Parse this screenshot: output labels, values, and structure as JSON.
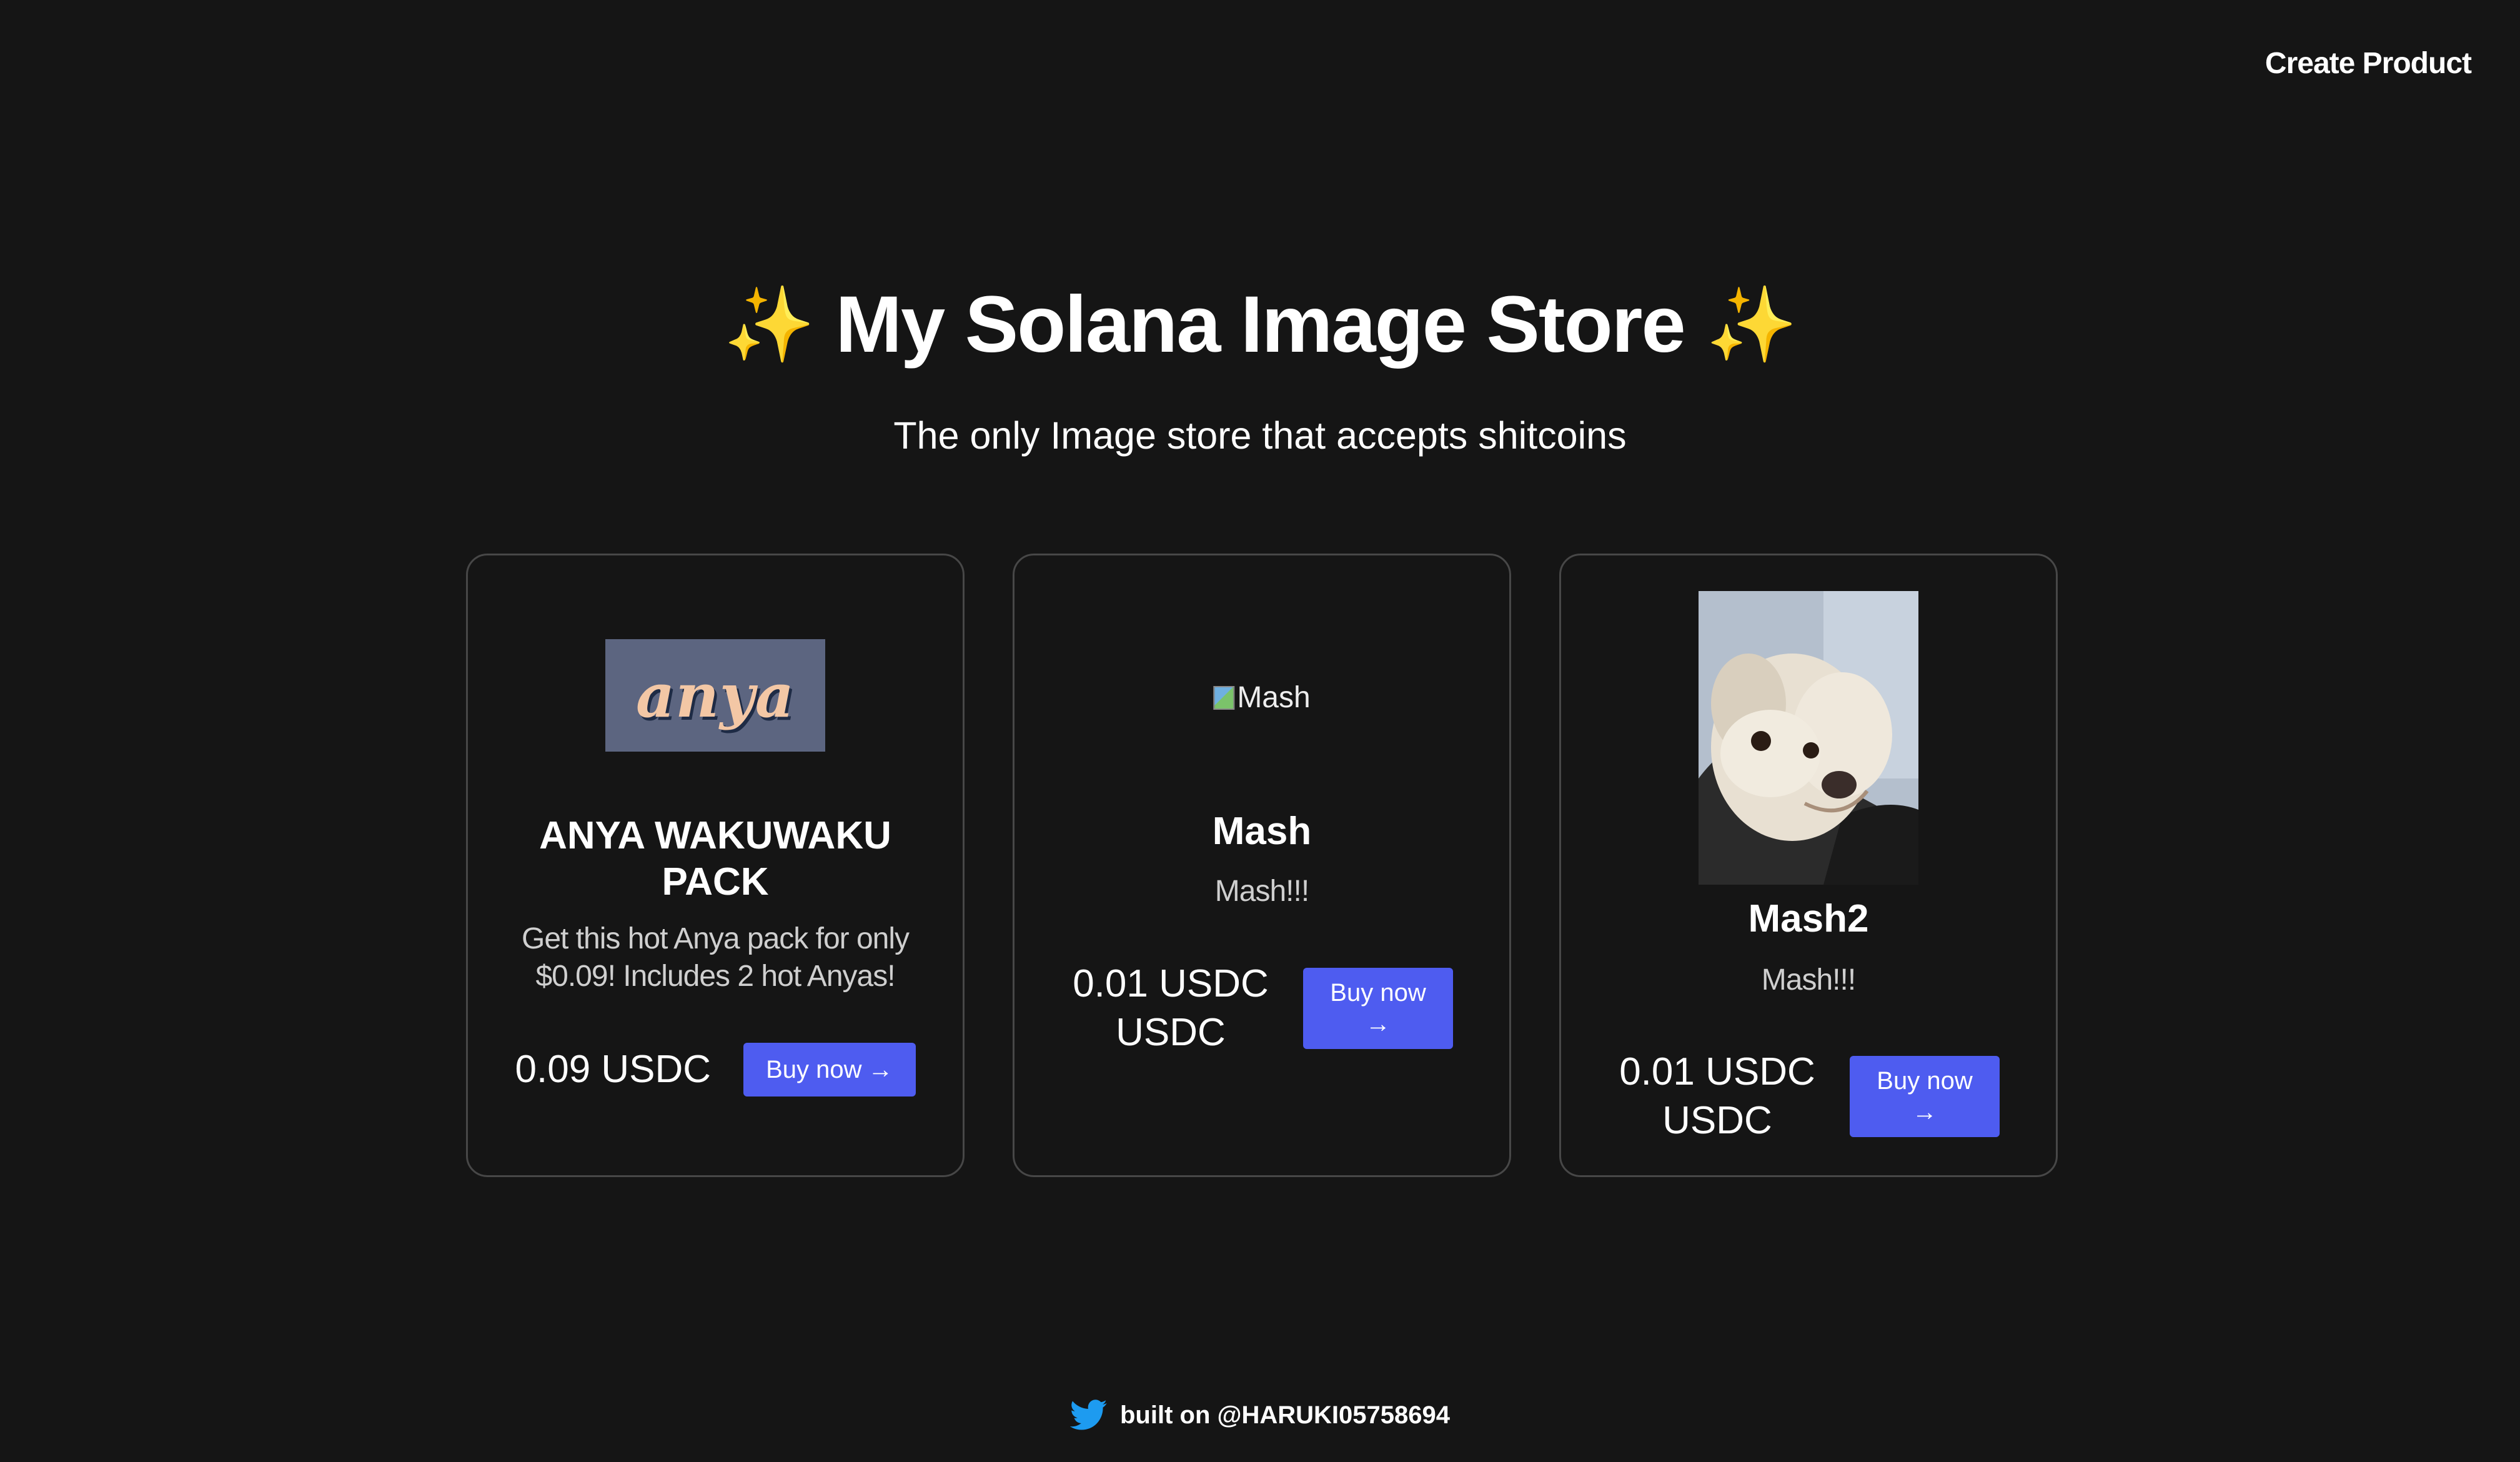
{
  "header": {
    "create_product_label": "Create Product"
  },
  "hero": {
    "sparkle_left": "✨",
    "title": "My Solana Image Store",
    "sparkle_right": "✨",
    "subtitle": "The only Image store that accepts shitcoins"
  },
  "products": [
    {
      "name": "ANYA WAKUWAKU PACK",
      "description": "Get this hot Anya pack for only $0.09! Includes 2 hot Anyas!",
      "price": "0.09 USDC",
      "image_text": "anya",
      "buy_label": "Buy now",
      "buy_arrow": "→"
    },
    {
      "name": "Mash",
      "description": "Mash!!!",
      "price": "0.01 USDC USDC",
      "image_alt": "Mash",
      "buy_label": "Buy now",
      "buy_arrow": "→"
    },
    {
      "name": "Mash2",
      "description": "Mash!!!",
      "price": "0.01 USDC USDC",
      "buy_label": "Buy now",
      "buy_arrow": "→"
    }
  ],
  "footer": {
    "text": "built on @HARUKI05758694",
    "icon": "twitter-icon"
  },
  "colors": {
    "background": "#151515",
    "button": "#4e5cf0",
    "card_border": "#474747",
    "twitter": "#1d9bf0"
  }
}
